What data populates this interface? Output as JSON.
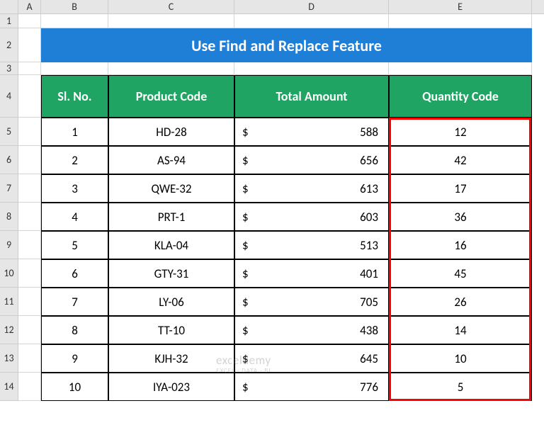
{
  "columns": [
    "A",
    "B",
    "C",
    "D",
    "E"
  ],
  "rowNumbers": [
    "1",
    "2",
    "3",
    "4",
    "5",
    "6",
    "7",
    "8",
    "9",
    "10",
    "11",
    "12",
    "13",
    "14"
  ],
  "title": "Use Find and Replace Feature",
  "headers": {
    "sl": "Sl. No.",
    "product": "Product Code",
    "amount": "Total Amount",
    "qty": "Quantity Code"
  },
  "currency": "$",
  "rows": [
    {
      "sl": "1",
      "product": "HD-28",
      "amount": "588",
      "qty": "12"
    },
    {
      "sl": "2",
      "product": "AS-94",
      "amount": "656",
      "qty": "42"
    },
    {
      "sl": "3",
      "product": "QWE-32",
      "amount": "613",
      "qty": "17"
    },
    {
      "sl": "4",
      "product": "PRT-1",
      "amount": "603",
      "qty": "36"
    },
    {
      "sl": "5",
      "product": "KLA-04",
      "amount": "513",
      "qty": "16"
    },
    {
      "sl": "6",
      "product": "GTY-31",
      "amount": "401",
      "qty": "45"
    },
    {
      "sl": "7",
      "product": "LY-06",
      "amount": "705",
      "qty": "26"
    },
    {
      "sl": "8",
      "product": "TT-10",
      "amount": "438",
      "qty": "14"
    },
    {
      "sl": "9",
      "product": "KJH-32",
      "amount": "645",
      "qty": "10"
    },
    {
      "sl": "10",
      "product": "IYA-023",
      "amount": "776",
      "qty": "5"
    }
  ],
  "watermark": {
    "line1": "exceldemy",
    "line2": "EXCEL · DATA · BI"
  }
}
